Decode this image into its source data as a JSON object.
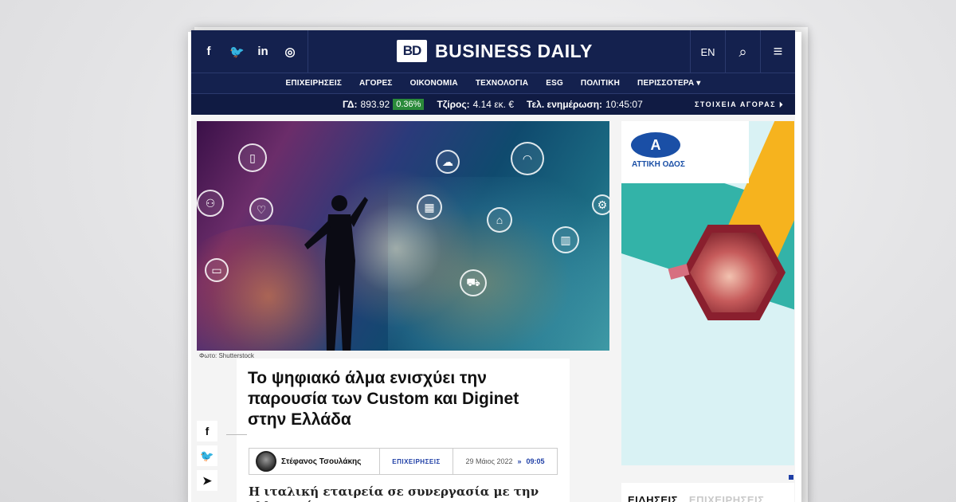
{
  "header": {
    "social_icons": [
      "facebook-icon",
      "twitter-icon",
      "linkedin-icon",
      "instagram-icon"
    ],
    "social_glyphs": [
      "f",
      "🐦",
      "in",
      "◎"
    ],
    "logo_mark": "BD",
    "logo_text": "BUSINESS DAILY",
    "lang": "EN",
    "search_glyph": "⌕",
    "menu_glyph": "≡"
  },
  "nav": {
    "items": [
      "ΕΠΙΧΕΙΡΗΣΕΙΣ",
      "ΑΓΟΡΕΣ",
      "ΟΙΚΟΝΟΜΙΑ",
      "ΤΕΧΝΟΛΟΓΙΑ",
      "ESG",
      "ΠΟΛΙΤΙΚΗ",
      "ΠΕΡΙΣΣΟΤΕΡΑ ▾"
    ]
  },
  "ticker": {
    "gd_label": "ΓΔ:",
    "gd_value": "893.92",
    "gd_change": "0.36%",
    "turnover_label": "Τζίρος:",
    "turnover_value": "4.14 εκ. €",
    "updated_label": "Τελ. ενημέρωση:",
    "updated_value": "10:45:07",
    "market_link": "ΣΤΟΙΧΕΙΑ ΑΓΟΡΑΣ ⏵"
  },
  "article": {
    "photo_credit": "Φωτο: Shutterstock",
    "title": "Το ψηφιακό άλμα ενισχύει την παρουσία των Custom και Diginet στην Ελλάδα",
    "author": "Στέφανος Τσουλάκης",
    "category": "ΕΠΙΧΕΙΡΗΣΕΙΣ",
    "date": "29 Μάιος 2022",
    "date_arrow": "»",
    "time": "09:05",
    "lede": "Η ιταλική εταιρεία σε συνεργασία με την ελληνική"
  },
  "share": {
    "glyphs": [
      "f",
      "🐦",
      "➤"
    ]
  },
  "ad": {
    "brand_label": "ΑΤΤΙΚΗ ΟΔΟΣ",
    "brand_mark": "A"
  },
  "news_tabs": {
    "active": "ΕΙΔΗΣΕΙΣ",
    "inactive": "ΕΠΙΧΕΙΡΗΣΕΙΣ"
  },
  "colors": {
    "header_bg": "#14214e",
    "accent_blue": "#1f3fa6",
    "positive_green": "#2a8a3a"
  }
}
